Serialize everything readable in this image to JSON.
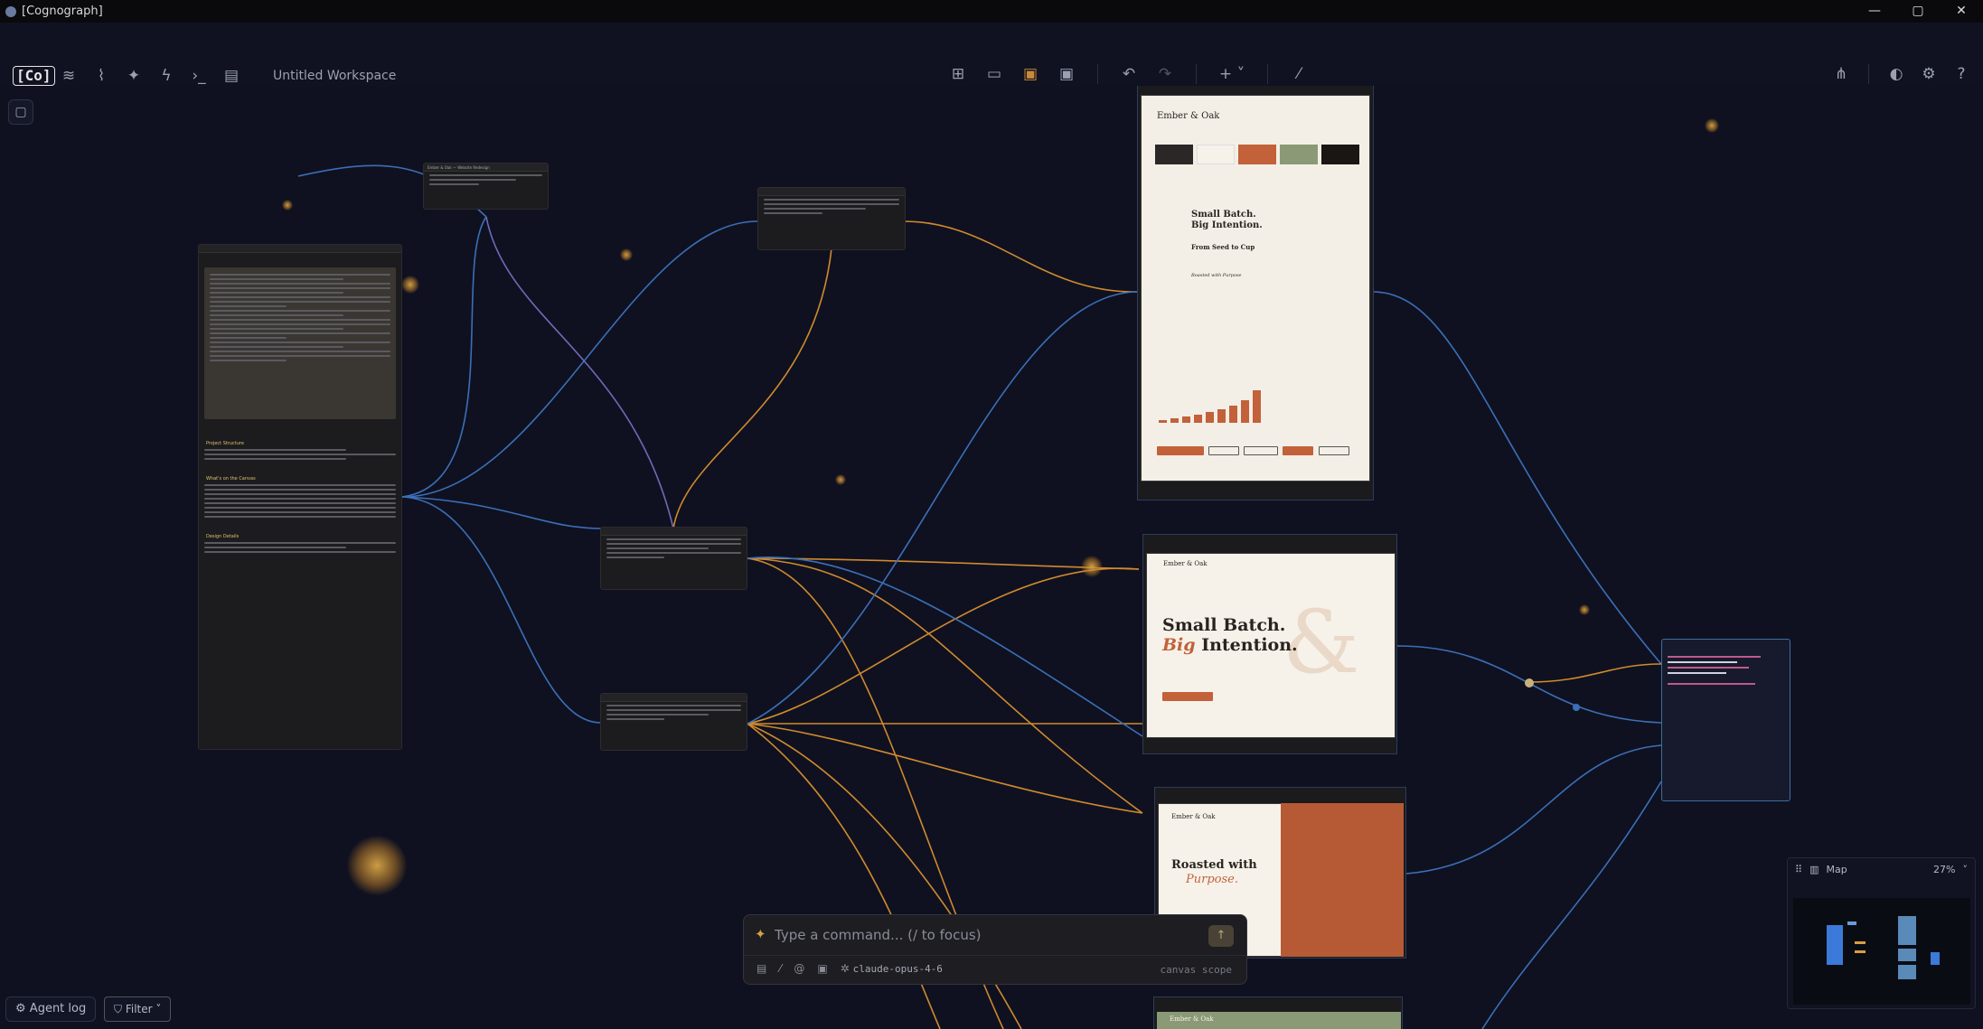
{
  "window": {
    "title": "[Cognograph]"
  },
  "toolbar": {
    "logo": "[Co]",
    "workspace_name": "Untitled Workspace",
    "add_label": "+ ˅"
  },
  "nodes": {
    "website_redesign_title": "Ember & Oak — Website Redesign",
    "brand_title": "Ember & Oak",
    "hero_line1": "Small Batch.",
    "hero_line2": "Big Intention.",
    "seed_to_cup": "From Seed to Cup",
    "roasted_with": "Roasted with Purpose",
    "landing_brand": "Ember & Oak",
    "landing_hero1": "Small Batch.",
    "landing_hero2a": "Big",
    "landing_hero2b": "Intention.",
    "purpose_brand": "Ember & Oak",
    "purpose_hero1": "Roasted with",
    "purpose_hero2": "Purpose.",
    "green_brand": "Ember & Oak",
    "project_structure": "Project Structure",
    "whats_on_canvas": "What's on the Canvas",
    "design_details": "Design Details"
  },
  "command": {
    "placeholder": "Type a command... (/ to focus)",
    "model": "claude-opus-4-6",
    "scope": "canvas scope"
  },
  "bottom": {
    "agent_log": "Agent log",
    "filter": "Filter"
  },
  "minimap": {
    "title": "Map",
    "zoom": "27%"
  },
  "colors": {
    "canvas_bg": "#0f1120",
    "edge_blue": "#3b6fb8",
    "edge_orange": "#d08a2e",
    "accent_rust": "#c2613a"
  }
}
